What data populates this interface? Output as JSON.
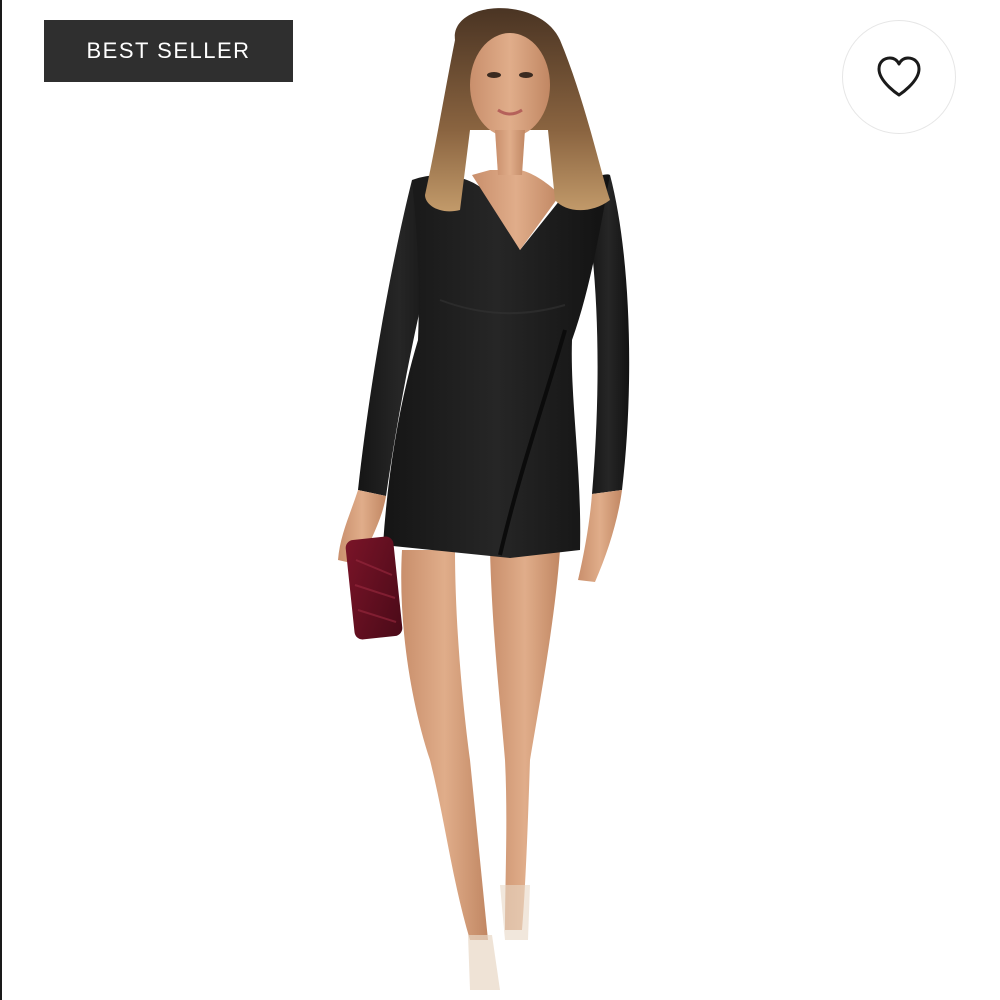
{
  "badge": {
    "label": "BEST SELLER",
    "background": "#2f2f2f",
    "text_color": "#ffffff"
  },
  "wishlist": {
    "icon": "heart-outline-icon",
    "state": "not-favorited"
  },
  "product_image": {
    "subject": "model-in-black-wrap-mini-dress",
    "accessory": "burgundy-velvet-clutch"
  }
}
